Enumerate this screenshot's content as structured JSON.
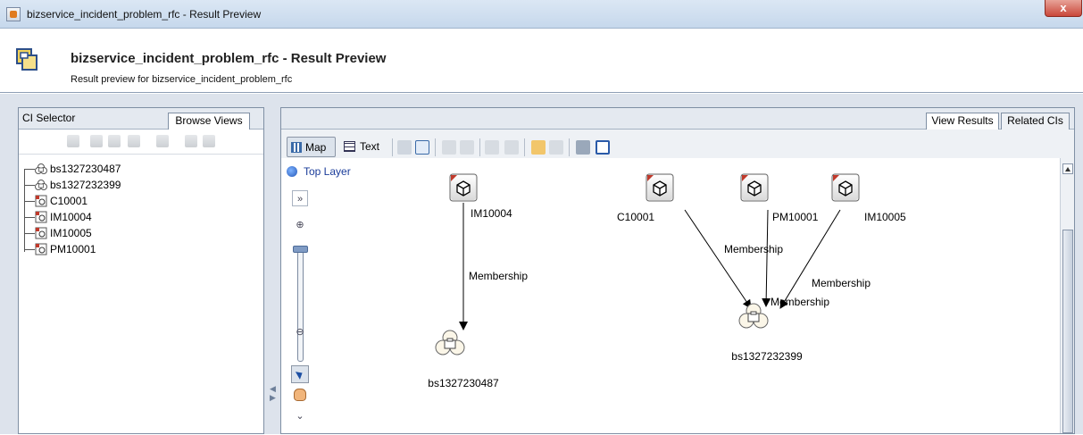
{
  "window": {
    "title": "bizservice_incident_problem_rfc - Result Preview",
    "close_label": "x"
  },
  "header": {
    "title": "bizservice_incident_problem_rfc - Result Preview",
    "subtitle": "Result preview for bizservice_incident_problem_rfc"
  },
  "left_panel": {
    "tabs": [
      "CI Selector",
      "Browse Views"
    ],
    "active_tab": "Browse Views",
    "tree": [
      {
        "label": "bs1327230487",
        "icon": "business-service-icon"
      },
      {
        "label": "bs1327232399",
        "icon": "business-service-icon"
      },
      {
        "label": "C10001",
        "icon": "ci-node-icon"
      },
      {
        "label": "IM10004",
        "icon": "ci-node-icon"
      },
      {
        "label": "IM10005",
        "icon": "ci-node-icon"
      },
      {
        "label": "PM10001",
        "icon": "ci-node-icon"
      }
    ]
  },
  "right_panel": {
    "tabs": [
      "View Results",
      "Related CIs"
    ],
    "active_tab": "View Results",
    "toolbar": {
      "map_label": "Map",
      "text_label": "Text"
    },
    "layer": "Top Layer",
    "graph": {
      "nodes": [
        {
          "id": "IM10004",
          "label": "IM10004",
          "type": "ci"
        },
        {
          "id": "C10001",
          "label": "C10001",
          "type": "ci"
        },
        {
          "id": "PM10001",
          "label": "PM10001",
          "type": "ci"
        },
        {
          "id": "IM10005",
          "label": "IM10005",
          "type": "ci"
        },
        {
          "id": "bs1327230487",
          "label": "bs1327230487",
          "type": "business-service"
        },
        {
          "id": "bs1327232399",
          "label": "bs1327232399",
          "type": "business-service"
        }
      ],
      "edges": [
        {
          "from": "IM10004",
          "to": "bs1327230487",
          "label": "Membership"
        },
        {
          "from": "C10001",
          "to": "bs1327232399",
          "label": "Membership"
        },
        {
          "from": "PM10001",
          "to": "bs1327232399",
          "label": "Membership"
        },
        {
          "from": "IM10005",
          "to": "bs1327232399",
          "label": "Membership"
        }
      ]
    }
  },
  "colors": {
    "accent": "#1a3c9a",
    "panel_bg": "#dde3ec",
    "titlebar": "#c6d8ec",
    "close": "#c9473a"
  }
}
